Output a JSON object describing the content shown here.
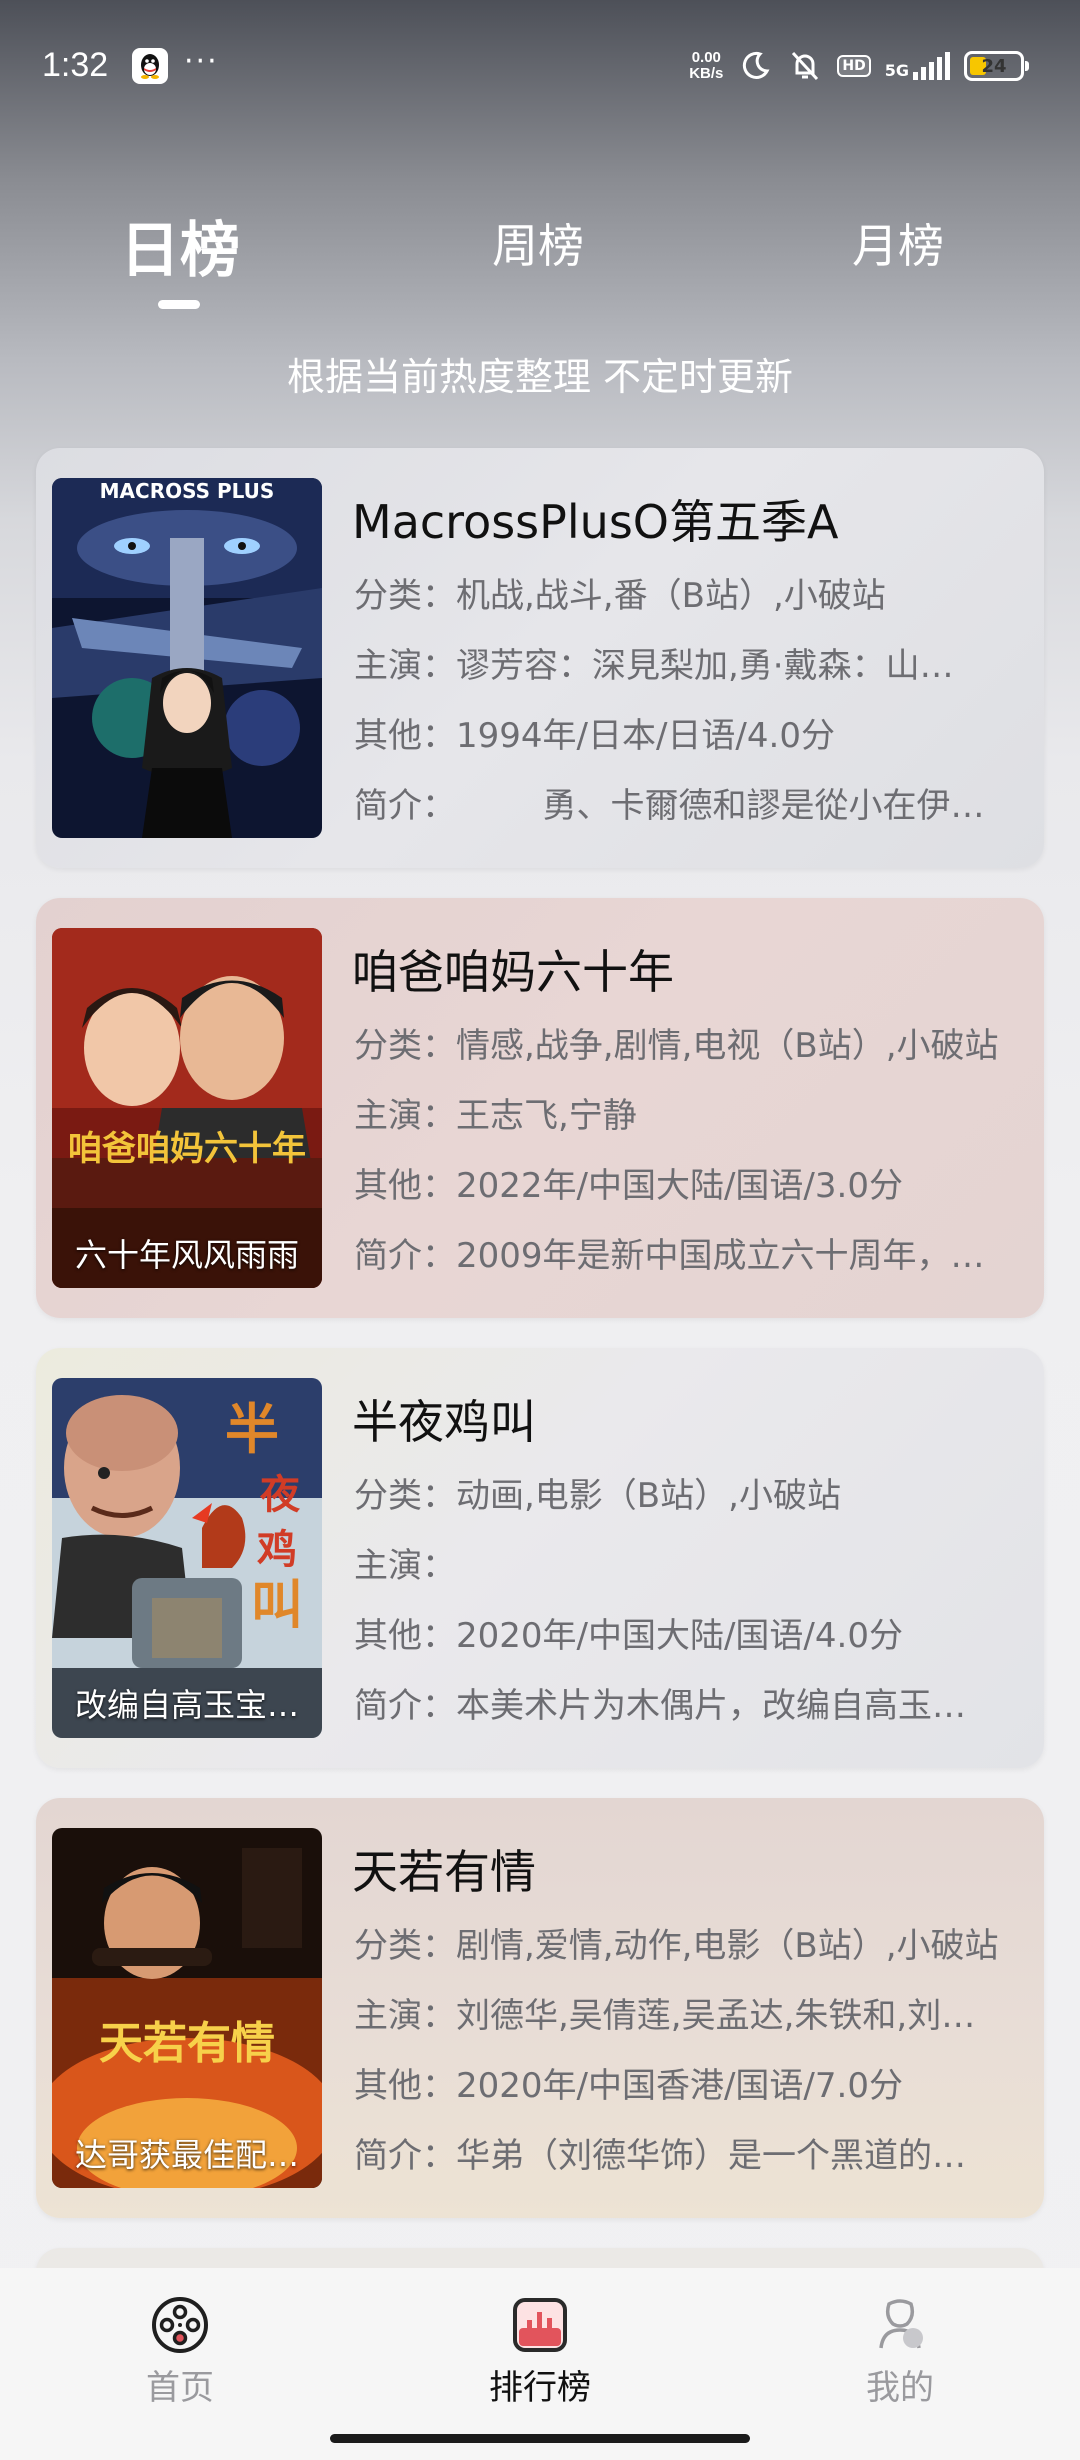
{
  "status_bar": {
    "time": "1:32",
    "more": "···",
    "speed_value": "0.00",
    "speed_unit": "KB/s",
    "hd": "HD",
    "network": "5G",
    "battery": "24"
  },
  "tabs": [
    {
      "label": "日榜",
      "active": true
    },
    {
      "label": "周榜",
      "active": false
    },
    {
      "label": "月榜",
      "active": false
    }
  ],
  "subtitle": "根据当前热度整理 不定时更新",
  "cards": [
    {
      "title": "MacrossPlusO第五季A",
      "category_label": "分类：",
      "category": "机战,战斗,番（B站）,小破站",
      "cast_label": "主演：",
      "cast": "谬芳容：深見梨加,勇·戴森：山…",
      "other_label": "其他：",
      "other": "1994年/日本/日语/4.0分",
      "intro_label": "简介：",
      "intro": "        勇、卡爾德和謬是從小在伊…",
      "poster_caption": "",
      "poster_text": "MACROSS PLUS"
    },
    {
      "title": "咱爸咱妈六十年",
      "category_label": "分类：",
      "category": "情感,战争,剧情,电视（B站）,小破站",
      "cast_label": "主演：",
      "cast": "王志飞,宁静",
      "other_label": "其他：",
      "other": "2022年/中国大陆/国语/3.0分",
      "intro_label": "简介：",
      "intro": "2009年是新中国成立六十周年，…",
      "poster_caption": "六十年风风雨雨",
      "poster_text": "咱爸咱妈六十年"
    },
    {
      "title": "半夜鸡叫",
      "category_label": "分类：",
      "category": "动画,电影（B站）,小破站",
      "cast_label": "主演：",
      "cast": "",
      "other_label": "其他：",
      "other": "2020年/中国大陆/国语/4.0分",
      "intro_label": "简介：",
      "intro": "本美术片为木偶片，改编自高玉…",
      "poster_caption": "改编自高玉宝…",
      "poster_text": "半夜鸡叫"
    },
    {
      "title": "天若有情",
      "category_label": "分类：",
      "category": "剧情,爱情,动作,电影（B站）,小破站",
      "cast_label": "主演：",
      "cast": "刘德华,吴倩莲,吴孟达,朱铁和,刘…",
      "other_label": "其他：",
      "other": "2020年/中国香港/国语/7.0分",
      "intro_label": "简介：",
      "intro": "华弟（刘德华饰）是一个黑道的…",
      "poster_caption": "达哥获最佳配…",
      "poster_text": "天若有情"
    }
  ],
  "bottom_nav": [
    {
      "label": "首页",
      "icon": "film-reel-icon",
      "active": false
    },
    {
      "label": "排行榜",
      "icon": "ranking-chart-icon",
      "active": true
    },
    {
      "label": "我的",
      "icon": "profile-icon",
      "active": false
    }
  ],
  "colors": {
    "accent": "#e2545c",
    "inactive_nav": "#9a9a9e",
    "info_text": "#6d6d72"
  }
}
